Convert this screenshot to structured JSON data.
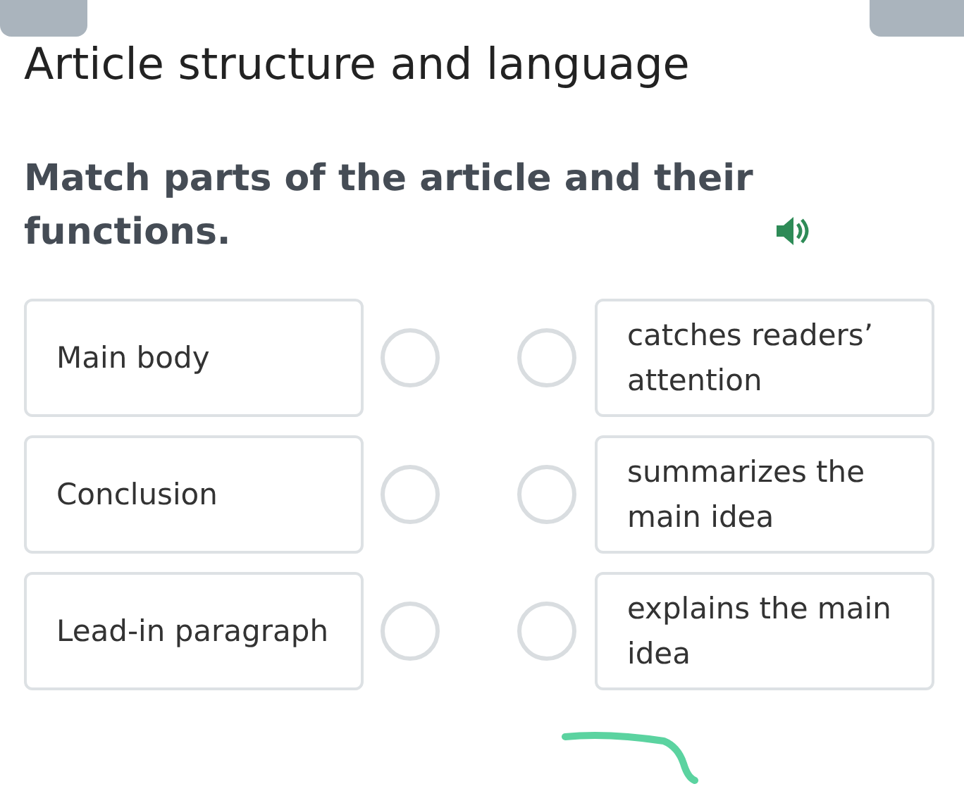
{
  "page_title": "Article structure and language",
  "question": "Match parts of the article and their functions.",
  "left_items": [
    {
      "label": "Main body",
      "selected": false
    },
    {
      "label": "Conclusion",
      "selected": false
    },
    {
      "label": "Lead-in paragraph",
      "selected": false
    }
  ],
  "right_items": [
    {
      "label": "catches readers’ attention",
      "selected": false
    },
    {
      "label": "summarizes the main idea",
      "selected": false
    },
    {
      "label": "explains the main idea",
      "selected": false
    }
  ]
}
